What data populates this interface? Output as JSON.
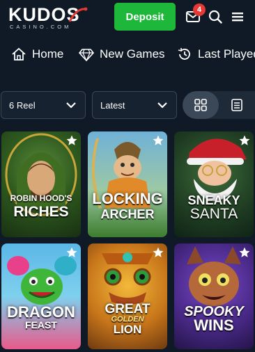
{
  "header": {
    "logo_main": "KUDOS",
    "logo_sub": "CASINO.COM",
    "deposit_label": "Deposit",
    "messages_badge": "4"
  },
  "nav": [
    {
      "label": "Home",
      "icon": "home-icon"
    },
    {
      "label": "New Games",
      "icon": "diamond-icon"
    },
    {
      "label": "Last Played",
      "icon": "history-icon"
    }
  ],
  "filters": {
    "reels": "6 Reel",
    "sort": "Latest"
  },
  "games": [
    {
      "line1": "ROBIN HOOD'S",
      "line2": "RICHES"
    },
    {
      "line1": "LOCKING",
      "line2": "ARCHER"
    },
    {
      "line1": "SNEAKY",
      "line2": "SANTA"
    },
    {
      "line1": "DRAGON",
      "line2": "FEAST"
    },
    {
      "line1": "GREAT",
      "line2": "GOLDEN",
      "line3": "LION"
    },
    {
      "line1": "SPOOKY",
      "line2": "WINS"
    }
  ],
  "colors": {
    "background": "#0f1a26",
    "deposit": "#1db83a",
    "badge": "#e53935",
    "logo_accent": "#e53935"
  }
}
